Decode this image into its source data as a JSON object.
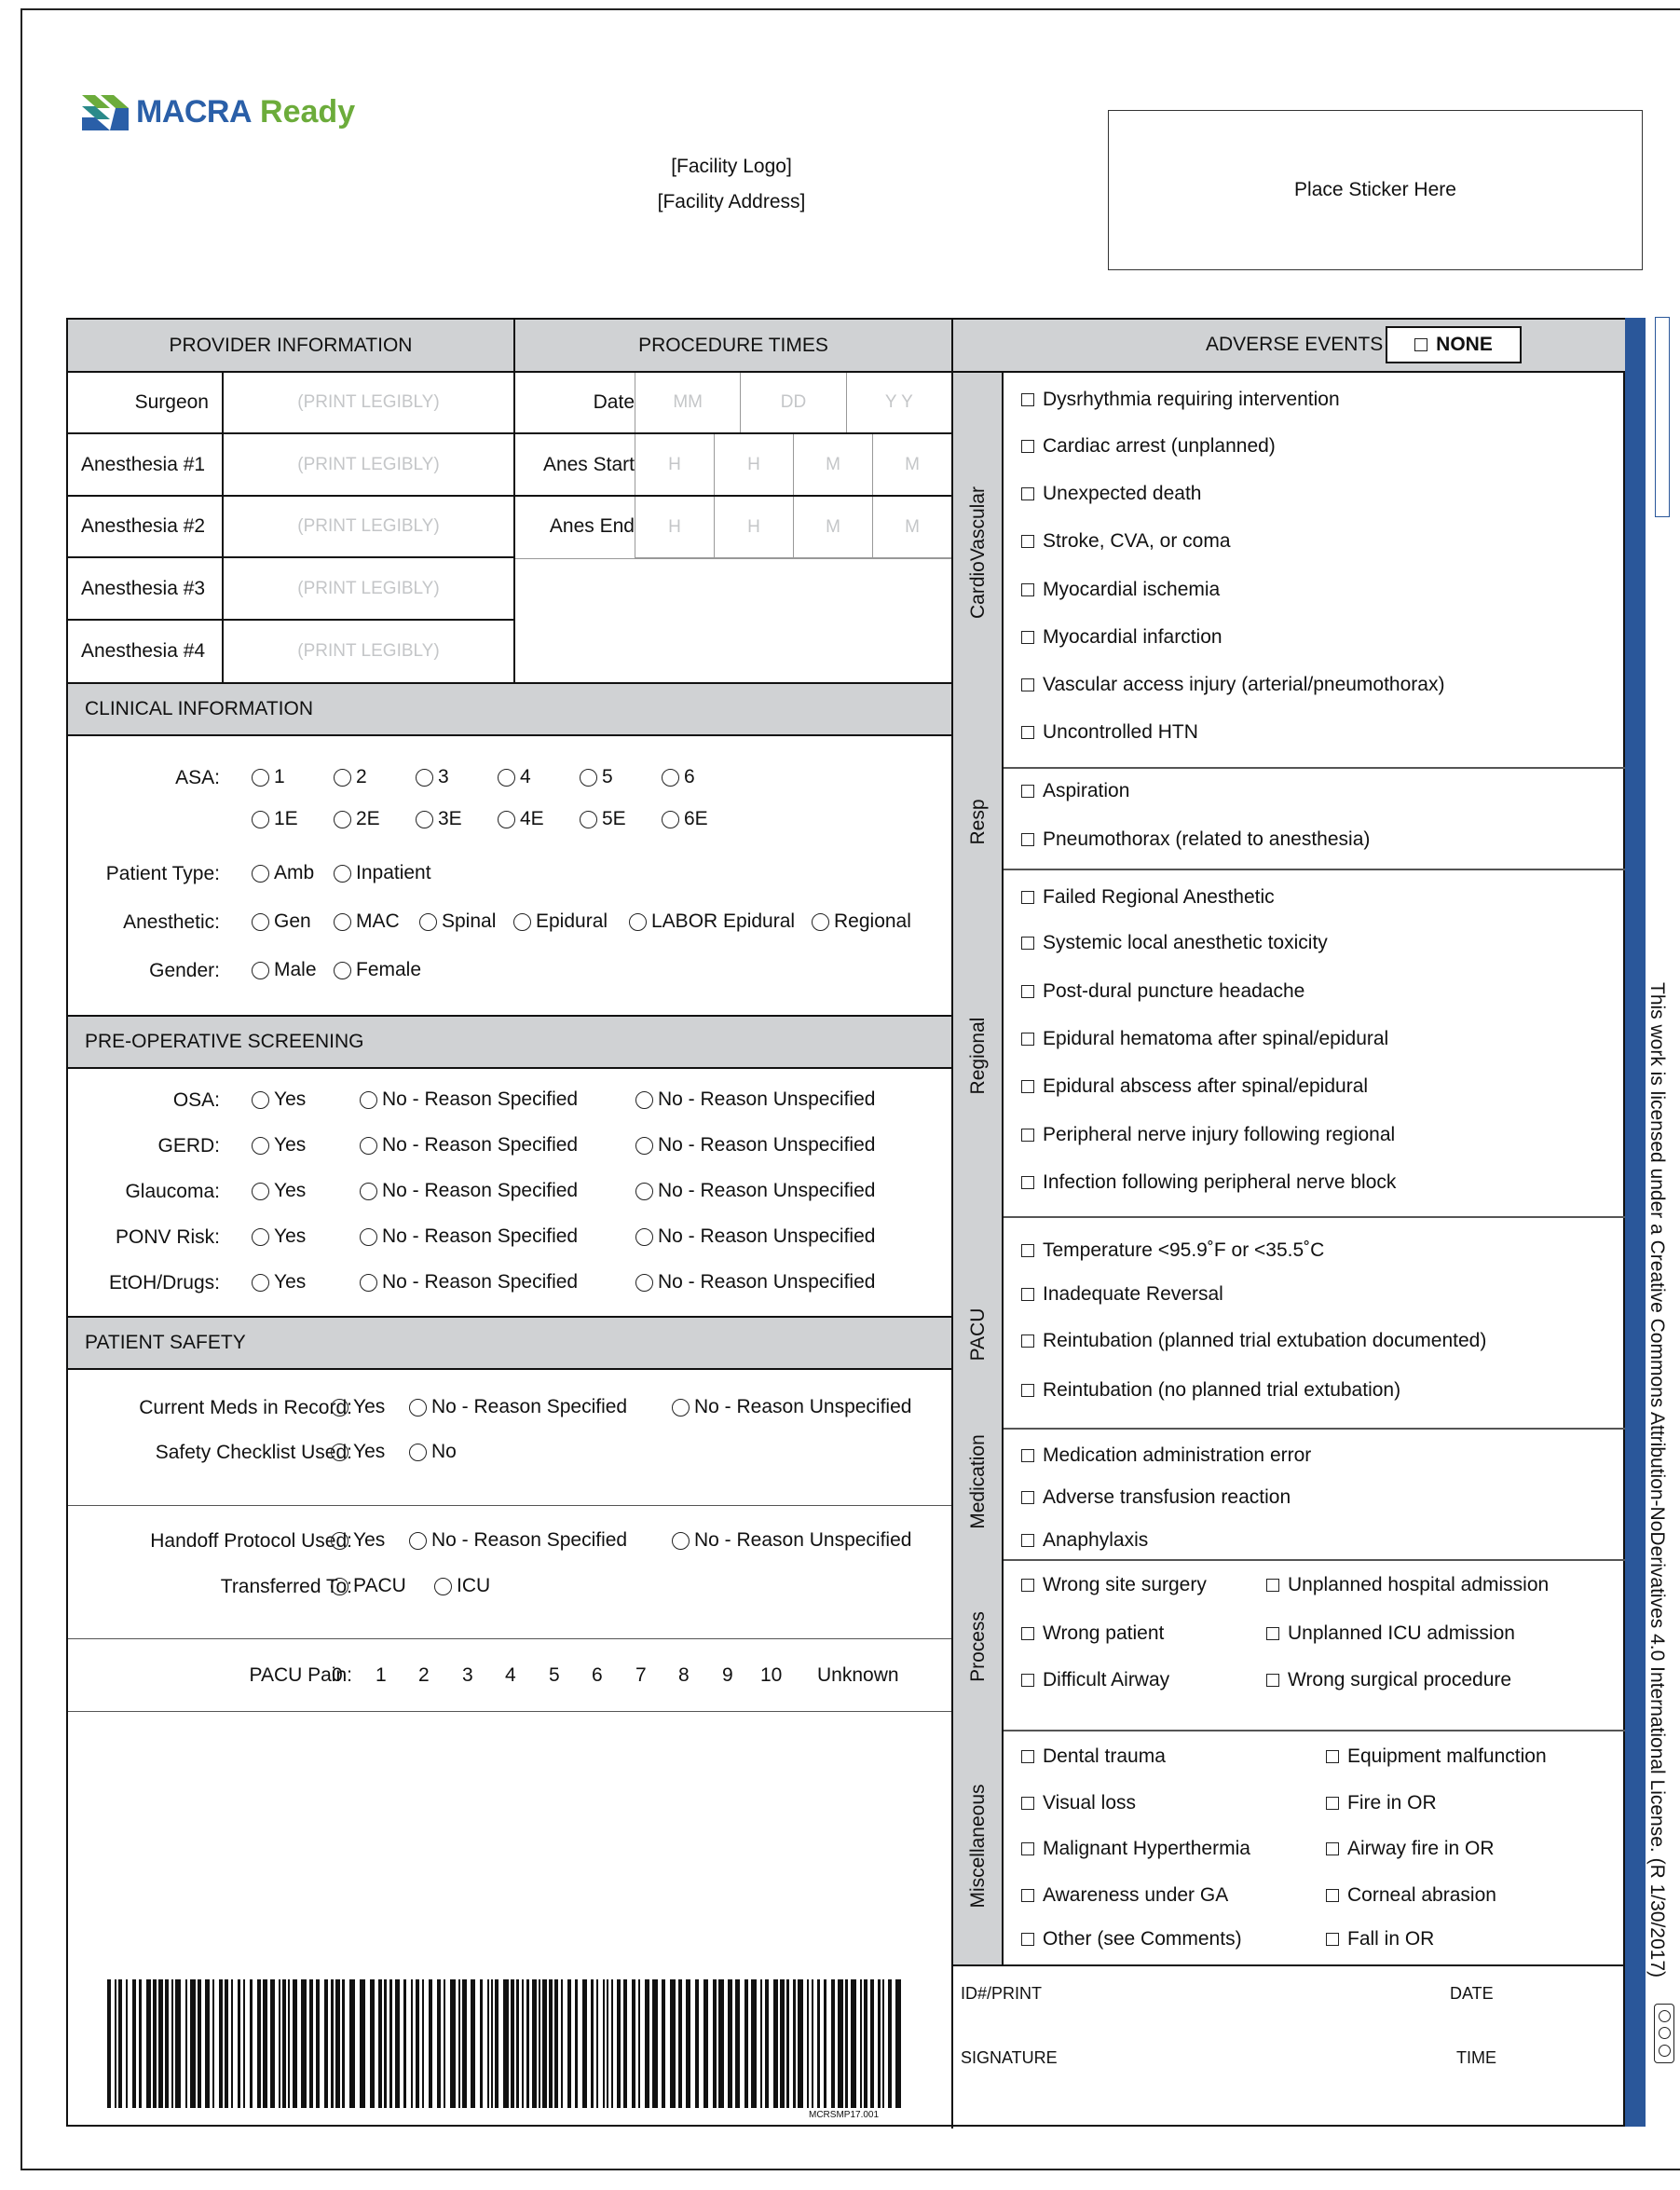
{
  "brand": {
    "name_part1": "MACRA",
    "name_part2": "Ready",
    "brand_color_blue": "#2a5fa8",
    "brand_color_green": "#6cac3b"
  },
  "facility": {
    "logo": "[Facility Logo]",
    "address": "[Facility Address]"
  },
  "sticker": "Place Sticker Here",
  "provider": {
    "header": "PROVIDER INFORMATION",
    "rows": [
      {
        "label": "Surgeon",
        "placeholder": "(PRINT LEGIBLY)"
      },
      {
        "label": "Anesthesia #1",
        "placeholder": "(PRINT LEGIBLY)"
      },
      {
        "label": "Anesthesia #2",
        "placeholder": "(PRINT LEGIBLY)"
      },
      {
        "label": "Anesthesia #3",
        "placeholder": "(PRINT LEGIBLY)"
      },
      {
        "label": "Anesthesia #4",
        "placeholder": "(PRINT LEGIBLY)"
      }
    ]
  },
  "times": {
    "header": "PROCEDURE TIMES",
    "date_label": "Date",
    "date_fields": [
      "MM",
      "DD",
      "Y Y"
    ],
    "start_label": "Anes Start",
    "end_label": "Anes End",
    "time_fields": [
      "H",
      "H",
      "M",
      "M"
    ]
  },
  "clinical": {
    "header": "CLINICAL INFORMATION",
    "asa_label": "ASA:",
    "asa_row1": [
      "1",
      "2",
      "3",
      "4",
      "5",
      "6"
    ],
    "asa_row2": [
      "1E",
      "2E",
      "3E",
      "4E",
      "5E",
      "6E"
    ],
    "patient_type_label": "Patient Type:",
    "patient_type": [
      "Amb",
      "Inpatient"
    ],
    "anesthetic_label": "Anesthetic:",
    "anesthetic": [
      "Gen",
      "MAC",
      "Spinal",
      "Epidural",
      "LABOR Epidural",
      "Regional"
    ],
    "gender_label": "Gender:",
    "gender": [
      "Male",
      "Female"
    ]
  },
  "preop": {
    "header": "PRE-OPERATIVE SCREENING",
    "rows": [
      "OSA:",
      "GERD:",
      "Glaucoma:",
      "PONV Risk:",
      "EtOH/Drugs:"
    ],
    "options": [
      "Yes",
      "No - Reason Specified",
      "No - Reason Unspecified"
    ]
  },
  "safety": {
    "header": "PATIENT SAFETY",
    "meds_label": "Current Meds in Record:",
    "checklist_label": "Safety Checklist Used:",
    "handoff_label": "Handoff Protocol Used:",
    "transferred_label": "Transferred To:",
    "three_options": [
      "Yes",
      "No - Reason Specified",
      "No - Reason Unspecified"
    ],
    "yes_no": [
      "Yes",
      "No"
    ],
    "transfer_options": [
      "PACU",
      "ICU"
    ],
    "pain_label": "PACU Pain:",
    "pain_scale": [
      "0",
      "1",
      "2",
      "3",
      "4",
      "5",
      "6",
      "7",
      "8",
      "9",
      "10",
      "Unknown"
    ]
  },
  "adverse": {
    "header": "ADVERSE EVENTS",
    "none_label": "NONE",
    "categories": [
      {
        "name": "CardioVascular",
        "items": [
          "Dysrhythmia requiring intervention",
          "Cardiac arrest (unplanned)",
          "Unexpected death",
          "Stroke, CVA, or coma",
          "Myocardial ischemia",
          "Myocardial infarction",
          "Vascular access injury (arterial/pneumothorax)",
          "Uncontrolled HTN"
        ]
      },
      {
        "name": "Resp",
        "items": [
          "Aspiration",
          "Pneumothorax (related to anesthesia)"
        ]
      },
      {
        "name": "Regional",
        "items": [
          "Failed Regional Anesthetic",
          "Systemic local anesthetic toxicity",
          "Post-dural puncture headache",
          "Epidural hematoma after spinal/epidural",
          "Epidural abscess after spinal/epidural",
          "Peripheral nerve injury following regional",
          "Infection following peripheral nerve block"
        ]
      },
      {
        "name": "PACU",
        "items": [
          "Temperature <95.9˚F or <35.5˚C",
          "Inadequate Reversal",
          "Reintubation (planned trial extubation documented)",
          "Reintubation (no planned trial extubation)"
        ]
      },
      {
        "name": "Medication",
        "items": [
          "Medication administration error",
          "Adverse transfusion reaction",
          "Anaphylaxis"
        ]
      },
      {
        "name": "Process",
        "left": [
          "Wrong site surgery",
          "Wrong patient",
          "Difficult Airway"
        ],
        "right": [
          "Unplanned hospital admission",
          "Unplanned ICU admission",
          "Wrong surgical procedure"
        ]
      },
      {
        "name": "Miscellaneous",
        "left": [
          "Dental trauma",
          "Visual loss",
          "Malignant Hyperthermia",
          "Awareness under GA",
          "Other (see Comments)"
        ],
        "right": [
          "Equipment malfunction",
          "Fire in OR",
          "Airway fire in OR",
          "Corneal abrasion",
          "Fall in OR"
        ]
      }
    ]
  },
  "signoff": {
    "id_label": "ID#/PRINT",
    "date_label": "DATE",
    "signature_label": "SIGNATURE",
    "time_label": "TIME"
  },
  "form_code": "MCRSMP17.001",
  "license": "This work is licensed under a Creative Commons Attribution-NoDerivatives 4.0 International License. (R 1/30/2017)",
  "sidebar_color": "#2a579a"
}
